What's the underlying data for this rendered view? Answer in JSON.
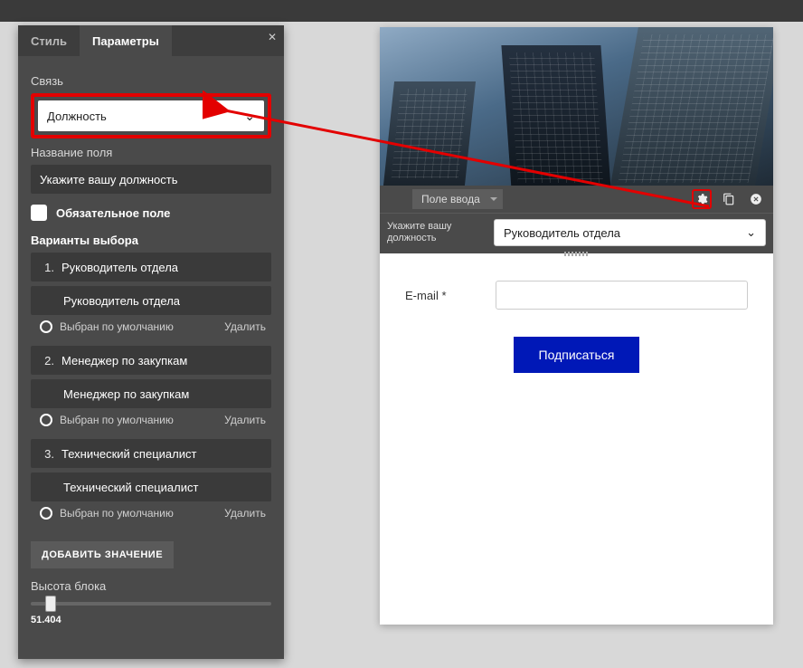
{
  "tabs": {
    "style": "Стиль",
    "params": "Параметры"
  },
  "panel": {
    "link_label": "Связь",
    "link_value": "Должность",
    "name_label": "Название поля",
    "name_value": "Укажите вашу должность",
    "required_label": "Обязательное поле",
    "options_label": "Варианты выбора",
    "default_label": "Выбран по умолчанию",
    "delete_label": "Удалить",
    "add_label": "ДОБАВИТЬ ЗНАЧЕНИЕ",
    "height_label": "Высота блока",
    "height_value": "51.404",
    "options": [
      {
        "n": "1.",
        "title": "Руководитель отдела",
        "value": "Руководитель отдела"
      },
      {
        "n": "2.",
        "title": "Менеджер по закупкам",
        "value": "Менеджер по закупкам"
      },
      {
        "n": "3.",
        "title": "Технический специалист",
        "value": "Технический специалист"
      }
    ]
  },
  "preview": {
    "toolbar_dd": "Поле ввода",
    "field_label": "Укажите вашу должность",
    "field_value": "Руководитель отдела",
    "email_label": "E-mail *",
    "submit": "Подписаться"
  }
}
